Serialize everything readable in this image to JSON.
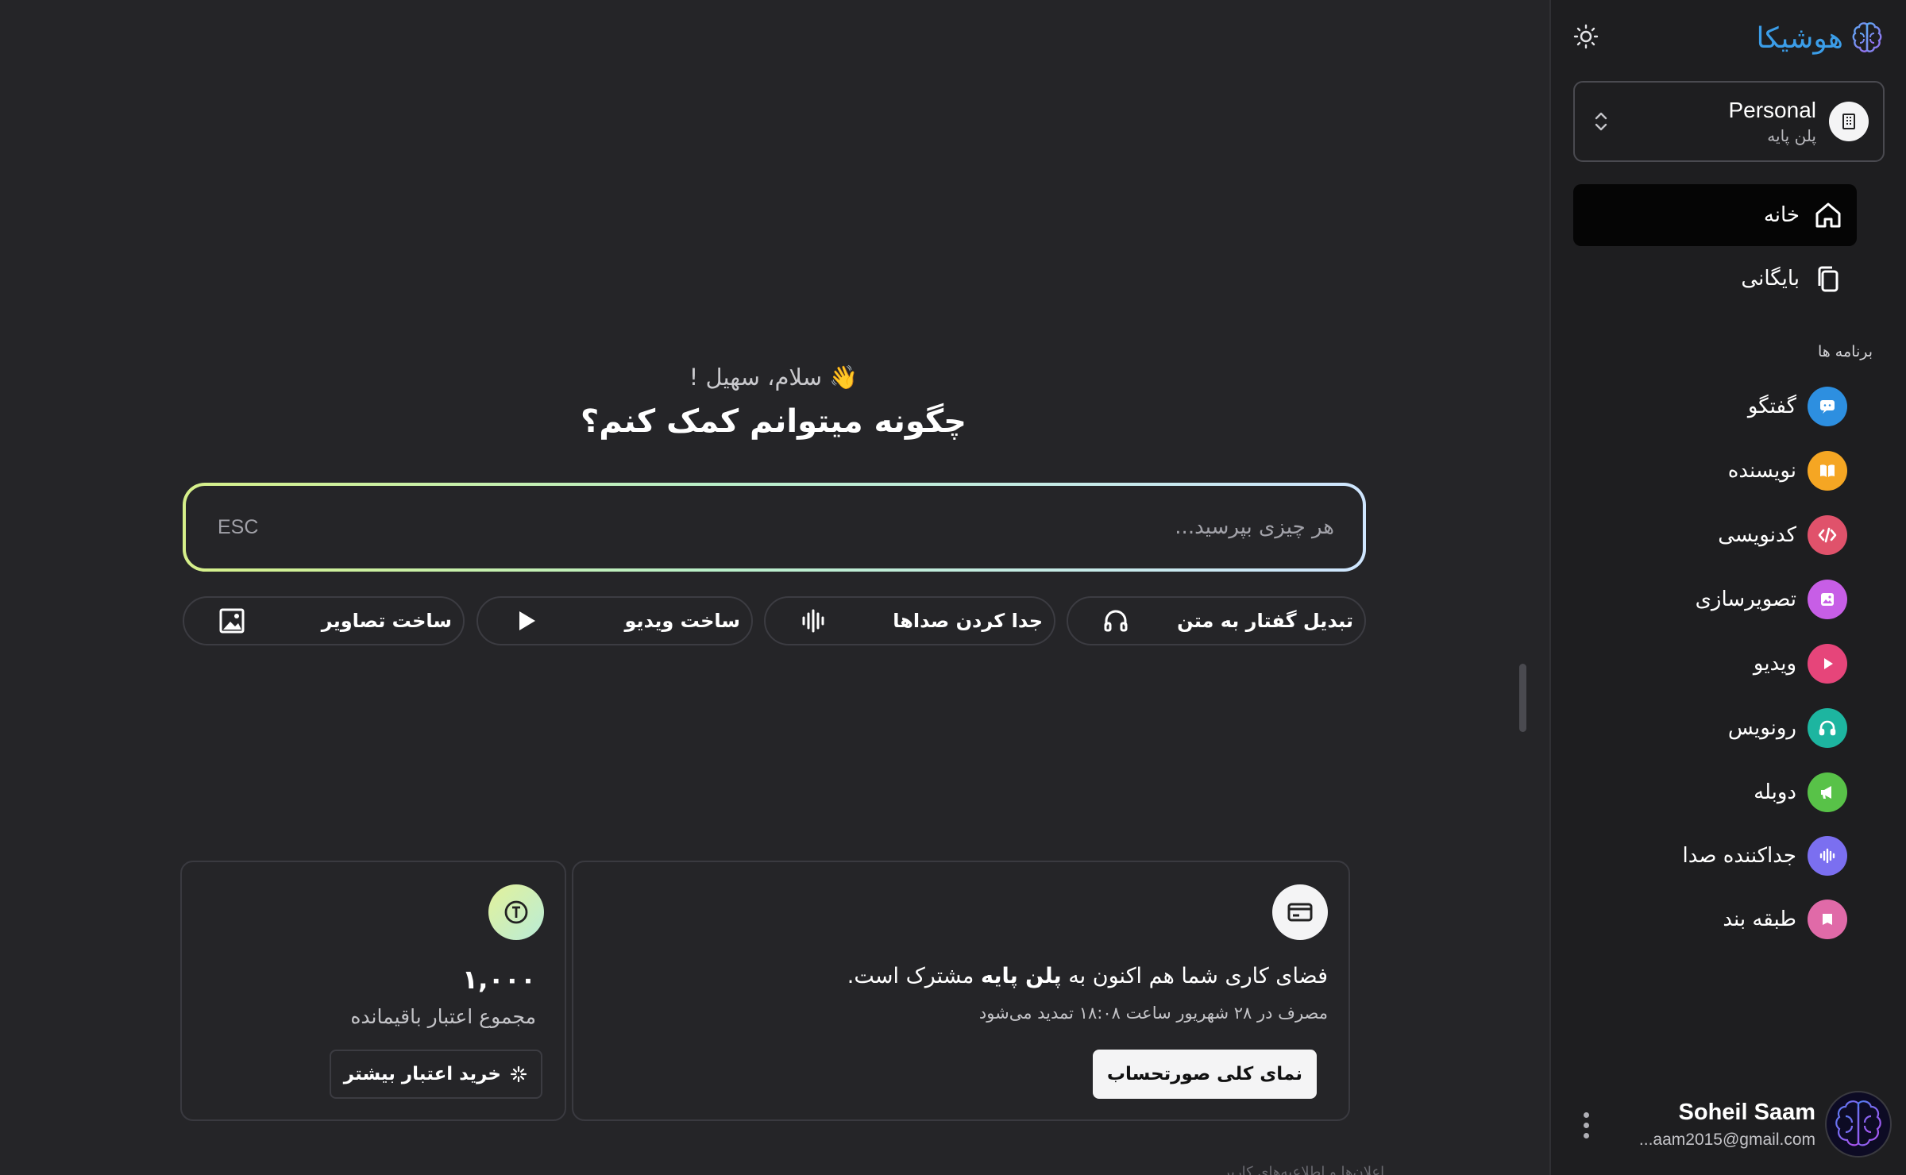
{
  "sidebar": {
    "logo_text": "هوشیکا",
    "workspace": {
      "name": "Personal",
      "plan": "پلن پایه"
    },
    "nav": [
      {
        "label": "خانه",
        "active": true
      },
      {
        "label": "بایگانی",
        "active": false
      }
    ],
    "apps_heading": "برنامه ها",
    "apps": [
      {
        "label": "گفتگو",
        "icon": "chat-icon",
        "color": "#2d8fe0"
      },
      {
        "label": "نویسنده",
        "icon": "book-icon",
        "color": "#f5a623"
      },
      {
        "label": "کدنویسی",
        "icon": "code-icon",
        "color": "#e0526b"
      },
      {
        "label": "تصویرسازی",
        "icon": "image-icon",
        "color": "#c75ee6"
      },
      {
        "label": "ویدیو",
        "icon": "play-icon",
        "color": "#e6457a"
      },
      {
        "label": "رونویس",
        "icon": "headphones-icon",
        "color": "#1db5a0"
      },
      {
        "label": "دوبله",
        "icon": "megaphone-icon",
        "color": "#58c248"
      },
      {
        "label": "جداکننده صدا",
        "icon": "waveform-icon",
        "color": "#7b6ff0"
      },
      {
        "label": "طبقه بند",
        "icon": "tag-icon",
        "color": "#e06aa8"
      }
    ],
    "user": {
      "name": "Soheil Saam",
      "email": "...aam2015@gmail.com"
    }
  },
  "main": {
    "greeting": "👋 سلام، سهیل !",
    "headline": "چگونه میتوانم کمک کنم؟",
    "prompt": {
      "placeholder": "هر چیزی بپرسید...",
      "shortcut": "ESC"
    },
    "quick_actions": [
      {
        "label": "تبدیل گفتار به متن",
        "icon": "headphones-icon"
      },
      {
        "label": "جدا کردن صداها",
        "icon": "waveform-icon"
      },
      {
        "label": "ساخت ویدیو",
        "icon": "play-icon"
      },
      {
        "label": "ساخت تصاویر",
        "icon": "image-icon"
      }
    ],
    "plan_card": {
      "text_before": "فضای کاری شما هم اکنون به",
      "plan_name": "پلن پایه",
      "text_after": "مشترک است.",
      "renewal": "مصرف در ۲۸ شهریور ساعت ۱۸:۰۸ تمدید می‌شود",
      "button": "نمای کلی صورتحساب"
    },
    "credit_card": {
      "amount": "۱,۰۰۰",
      "label": "مجموع اعتبار باقیمانده",
      "button": "خرید اعتبار بیشتر"
    },
    "footer_partial": "اعلان‌ها و اطلاعیه‌های کاربر"
  }
}
